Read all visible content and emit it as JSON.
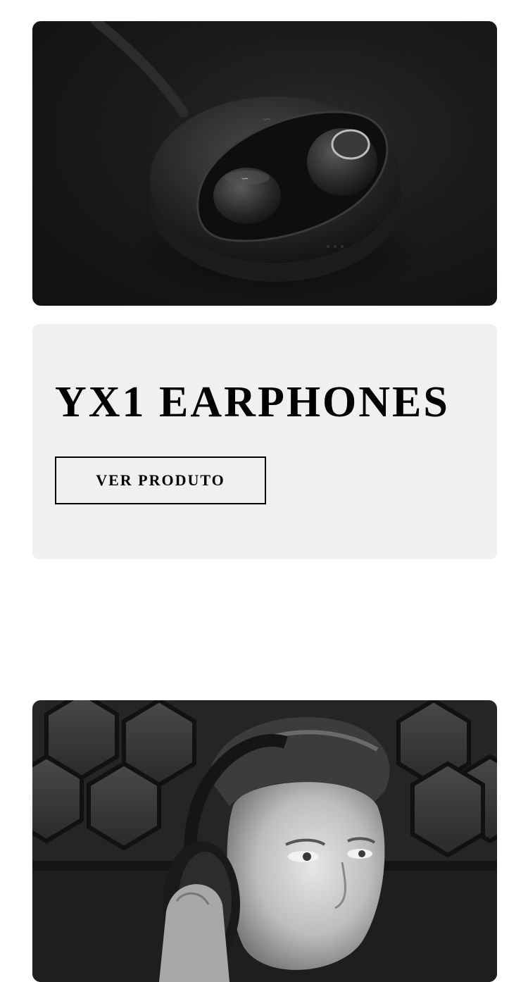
{
  "product": {
    "title": "YX1 EARPHONES",
    "button_label": "VER PRODUTO"
  },
  "colors": {
    "card_background": "#f0f0f0",
    "text": "#000000",
    "page_background": "#ffffff"
  }
}
